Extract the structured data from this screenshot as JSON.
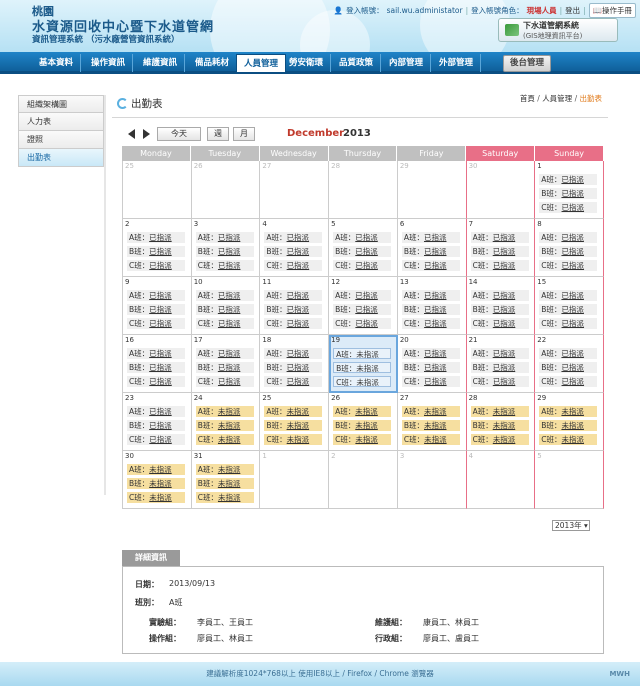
{
  "header": {
    "city": "桃園",
    "title": "水資源回收中心暨下水道管網",
    "subtitle": "資訊管理系統 （污水廠營管資訊系統）",
    "login_label": "登入帳號：",
    "login_account": "sail.wu.administator",
    "role_label": "登入帳號角色：",
    "role": "現場人員",
    "logout": "登出",
    "manual": "操作手冊",
    "gis_title": "下水道管網系統",
    "gis_sub": "(GIS地理資訊平台)"
  },
  "nav": {
    "items": [
      "基本資料",
      "操作資訊",
      "維護資訊",
      "備品耗材",
      "人員管理",
      "勞安衛環",
      "品質政策",
      "內部管理",
      "外部管理"
    ],
    "active_index": 4,
    "admin": "後台管理"
  },
  "sidebar": {
    "items": [
      "組織架構圖",
      "人力表",
      "證照",
      "出勤表"
    ],
    "active_index": 3
  },
  "page": {
    "title": "出勤表",
    "breadcrumb": [
      "首頁",
      "人員管理",
      "出勤表"
    ]
  },
  "toolbar": {
    "today": "今天",
    "week": "週",
    "month": "月",
    "month_label": "December",
    "year_label": "2013"
  },
  "calendar": {
    "weekdays": [
      "Monday",
      "Tuesday",
      "Wednesday",
      "Thursday",
      "Friday",
      "Saturday",
      "Sunday"
    ],
    "shift_labels": [
      "A班：",
      "B班：",
      "C班："
    ],
    "assigned": "已指派",
    "unassigned": "未指派",
    "today_day": 19,
    "days": [
      {
        "d": 25,
        "other": true,
        "shifts": []
      },
      {
        "d": 26,
        "other": true,
        "shifts": []
      },
      {
        "d": 27,
        "other": true,
        "shifts": []
      },
      {
        "d": 28,
        "other": true,
        "shifts": []
      },
      {
        "d": 29,
        "other": true,
        "shifts": []
      },
      {
        "d": 30,
        "other": true,
        "shifts": []
      },
      {
        "d": 1,
        "shifts": [
          "a",
          "a",
          "a"
        ]
      },
      {
        "d": 2,
        "shifts": [
          "a",
          "a",
          "a"
        ]
      },
      {
        "d": 3,
        "shifts": [
          "a",
          "a",
          "a"
        ]
      },
      {
        "d": 4,
        "shifts": [
          "a",
          "a",
          "a"
        ]
      },
      {
        "d": 5,
        "shifts": [
          "a",
          "a",
          "a"
        ]
      },
      {
        "d": 6,
        "shifts": [
          "a",
          "a",
          "a"
        ]
      },
      {
        "d": 7,
        "shifts": [
          "a",
          "a",
          "a"
        ]
      },
      {
        "d": 8,
        "shifts": [
          "a",
          "a",
          "a"
        ]
      },
      {
        "d": 9,
        "shifts": [
          "a",
          "a",
          "a"
        ]
      },
      {
        "d": 10,
        "shifts": [
          "a",
          "a",
          "a"
        ]
      },
      {
        "d": 11,
        "shifts": [
          "a",
          "a",
          "a"
        ]
      },
      {
        "d": 12,
        "shifts": [
          "a",
          "a",
          "a"
        ]
      },
      {
        "d": 13,
        "shifts": [
          "a",
          "a",
          "a"
        ]
      },
      {
        "d": 14,
        "shifts": [
          "a",
          "a",
          "a"
        ]
      },
      {
        "d": 15,
        "shifts": [
          "a",
          "a",
          "a"
        ]
      },
      {
        "d": 16,
        "shifts": [
          "a",
          "a",
          "a"
        ]
      },
      {
        "d": 17,
        "shifts": [
          "a",
          "a",
          "a"
        ]
      },
      {
        "d": 18,
        "shifts": [
          "a",
          "a",
          "a"
        ]
      },
      {
        "d": 19,
        "shifts": [
          "u",
          "u",
          "u"
        ]
      },
      {
        "d": 20,
        "shifts": [
          "a",
          "a",
          "a"
        ]
      },
      {
        "d": 21,
        "shifts": [
          "a",
          "a",
          "a"
        ]
      },
      {
        "d": 22,
        "shifts": [
          "a",
          "a",
          "a"
        ]
      },
      {
        "d": 23,
        "shifts": [
          "a",
          "a",
          "a"
        ]
      },
      {
        "d": 24,
        "shifts": [
          "U",
          "U",
          "U"
        ]
      },
      {
        "d": 25,
        "shifts": [
          "U",
          "U",
          "U"
        ]
      },
      {
        "d": 26,
        "shifts": [
          "U",
          "U",
          "U"
        ]
      },
      {
        "d": 27,
        "shifts": [
          "U",
          "U",
          "U"
        ]
      },
      {
        "d": 28,
        "shifts": [
          "U",
          "U",
          "U"
        ]
      },
      {
        "d": 29,
        "shifts": [
          "U",
          "U",
          "U"
        ]
      },
      {
        "d": 30,
        "shifts": [
          "U",
          "U",
          "U"
        ]
      },
      {
        "d": 31,
        "shifts": [
          "U",
          "U",
          "U"
        ]
      },
      {
        "d": 1,
        "other": true,
        "shifts": []
      },
      {
        "d": 2,
        "other": true,
        "shifts": []
      },
      {
        "d": 3,
        "other": true,
        "shifts": []
      },
      {
        "d": 4,
        "other": true,
        "shifts": []
      },
      {
        "d": 5,
        "other": true,
        "shifts": []
      }
    ]
  },
  "year_select": "2013年",
  "detail": {
    "tab": "詳細資訊",
    "date_label": "日期：",
    "date": "2013/09/13",
    "shift_label": "班別：",
    "shift": "A班",
    "groups": [
      {
        "label": "實驗組：",
        "value": "李員工、王員工"
      },
      {
        "label": "維護組：",
        "value": "康員工、林員工"
      },
      {
        "label": "操作組：",
        "value": "廖員工、林員工"
      },
      {
        "label": "行政組：",
        "value": "廖員工、盧員工"
      }
    ]
  },
  "footer": {
    "text": "建議解析度1024*768以上 使用IE8以上 / Firefox / Chrome 瀏覽器",
    "logo": "MWH"
  },
  "colors": {
    "nav": "#1f84c8",
    "weekend": "#e86f87",
    "month": "#c0392b",
    "unassigned": "#f6dfa0"
  }
}
